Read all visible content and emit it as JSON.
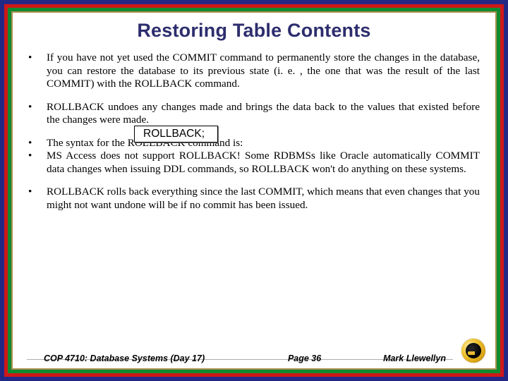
{
  "title": "Restoring Table Contents",
  "bullets": {
    "b1": "If you have not yet used the COMMIT command to permanently store the changes in the database, you can restore the database to its previous state (i. e. , the one that was the result of the last COMMIT) with the ROLLBACK command.",
    "b2": "ROLLBACK undoes any changes made and brings the data back to the values that existed before the changes were made.",
    "b3": "The syntax for the ROLLBACK command is:",
    "code": "ROLLBACK;",
    "b4": "MS Access does not support ROLLBACK!  Some RDBMSs like Oracle automatically COMMIT data changes when issuing DDL commands, so ROLLBACK won't do anything on these systems.",
    "b5": "ROLLBACK rolls back everything since the last COMMIT, which means that even changes that you might not want undone will be if no commit has been issued."
  },
  "footer": {
    "course": "COP 4710: Database Systems (Day 17)",
    "page": "Page 36",
    "author": "Mark Llewellyn"
  }
}
